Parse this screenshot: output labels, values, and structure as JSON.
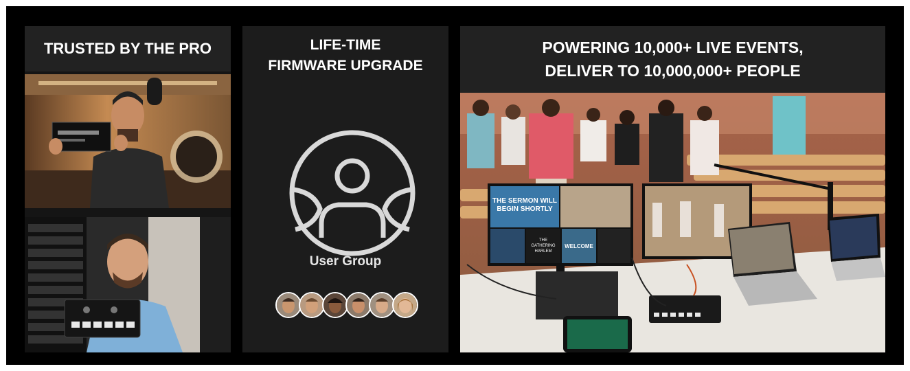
{
  "panels": {
    "left": {
      "title": "TRUSTED BY THE PRO"
    },
    "middle": {
      "title_line1": "LIFE-TIME",
      "title_line2": "FIRMWARE UPGRADE",
      "icon": "user-group-circle-icon",
      "label": "User Group",
      "avatars": [
        {
          "name": "avatar-1",
          "skin": "#c9966e",
          "hair": "#3b2a20"
        },
        {
          "name": "avatar-2",
          "skin": "#d1a07a",
          "hair": "#6a4a30"
        },
        {
          "name": "avatar-3",
          "skin": "#8a5a3c",
          "hair": "#1e1410"
        },
        {
          "name": "avatar-4",
          "skin": "#c88f6a",
          "hair": "#2e2018"
        },
        {
          "name": "avatar-5",
          "skin": "#d8aa88",
          "hair": "#5a3e2a"
        },
        {
          "name": "avatar-6",
          "skin": "#e2b896",
          "hair": "#a8743e"
        }
      ]
    },
    "right": {
      "title_line1": "POWERING 10,000+ LIVE EVENTS,",
      "title_line2": "DELIVER TO 10,000,000+ PEOPLE"
    }
  },
  "monitor_text": {
    "sermon_line1": "THE SERMON WILL",
    "sermon_line2": "BEGIN SHORTLY",
    "gathering_line1": "THE",
    "gathering_line2": "GATHERING",
    "gathering_line3": "HARLEM",
    "welcome": "WELCOME"
  },
  "colors": {
    "background": "#000000",
    "panel": "#1c1c1c",
    "text": "#ffffff"
  }
}
